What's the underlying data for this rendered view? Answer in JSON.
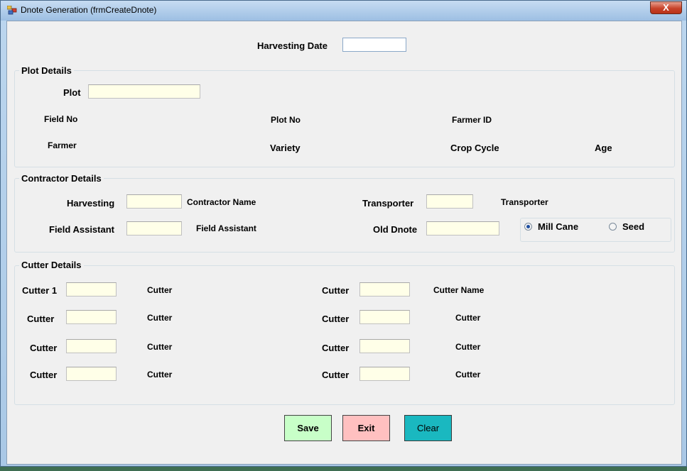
{
  "window": {
    "title": "Dnote Generation (frmCreateDnote)",
    "close_label": "X"
  },
  "header": {
    "harvesting_date_label": "Harvesting Date",
    "harvesting_date_value": ""
  },
  "plot_details": {
    "legend": "Plot Details",
    "plot_label": "Plot",
    "plot_value": "",
    "field_no": "Field No",
    "plot_no": "Plot No",
    "farmer_id": "Farmer ID",
    "farmer": "Farmer",
    "variety": "Variety",
    "crop_cycle": "Crop Cycle",
    "age": "Age"
  },
  "contractor_details": {
    "legend": "Contractor Details",
    "harvesting_label": "Harvesting",
    "contractor_name": "Contractor Name",
    "transporter_label": "Transporter",
    "transporter_name": "Transporter",
    "field_assistant_label": "Field Assistant",
    "field_assistant_name": "Field Assistant",
    "old_dnote_label": "Old Dnote",
    "cane_type": {
      "mill_cane": "Mill Cane",
      "seed": "Seed",
      "selected": "Mill Cane"
    }
  },
  "cutter_details": {
    "legend": "Cutter Details",
    "left": [
      {
        "label": "Cutter 1",
        "name": "Cutter"
      },
      {
        "label": "Cutter",
        "name": "Cutter"
      },
      {
        "label": "Cutter",
        "name": "Cutter"
      },
      {
        "label": "Cutter",
        "name": "Cutter"
      }
    ],
    "right": [
      {
        "label": "Cutter",
        "name": "Cutter Name"
      },
      {
        "label": "Cutter",
        "name": "Cutter"
      },
      {
        "label": "Cutter",
        "name": "Cutter"
      },
      {
        "label": "Cutter",
        "name": "Cutter"
      }
    ]
  },
  "actions": {
    "save": "Save",
    "exit": "Exit",
    "clear": "Clear"
  },
  "colors": {
    "input_bg": "#ffffe8",
    "save_bg": "#c8ffc8",
    "exit_bg": "#ffc0c0",
    "clear_bg": "#1ab8c0",
    "close_bg": "#c8432a"
  },
  "icons": {
    "app": "app-icon",
    "close": "close-icon"
  }
}
